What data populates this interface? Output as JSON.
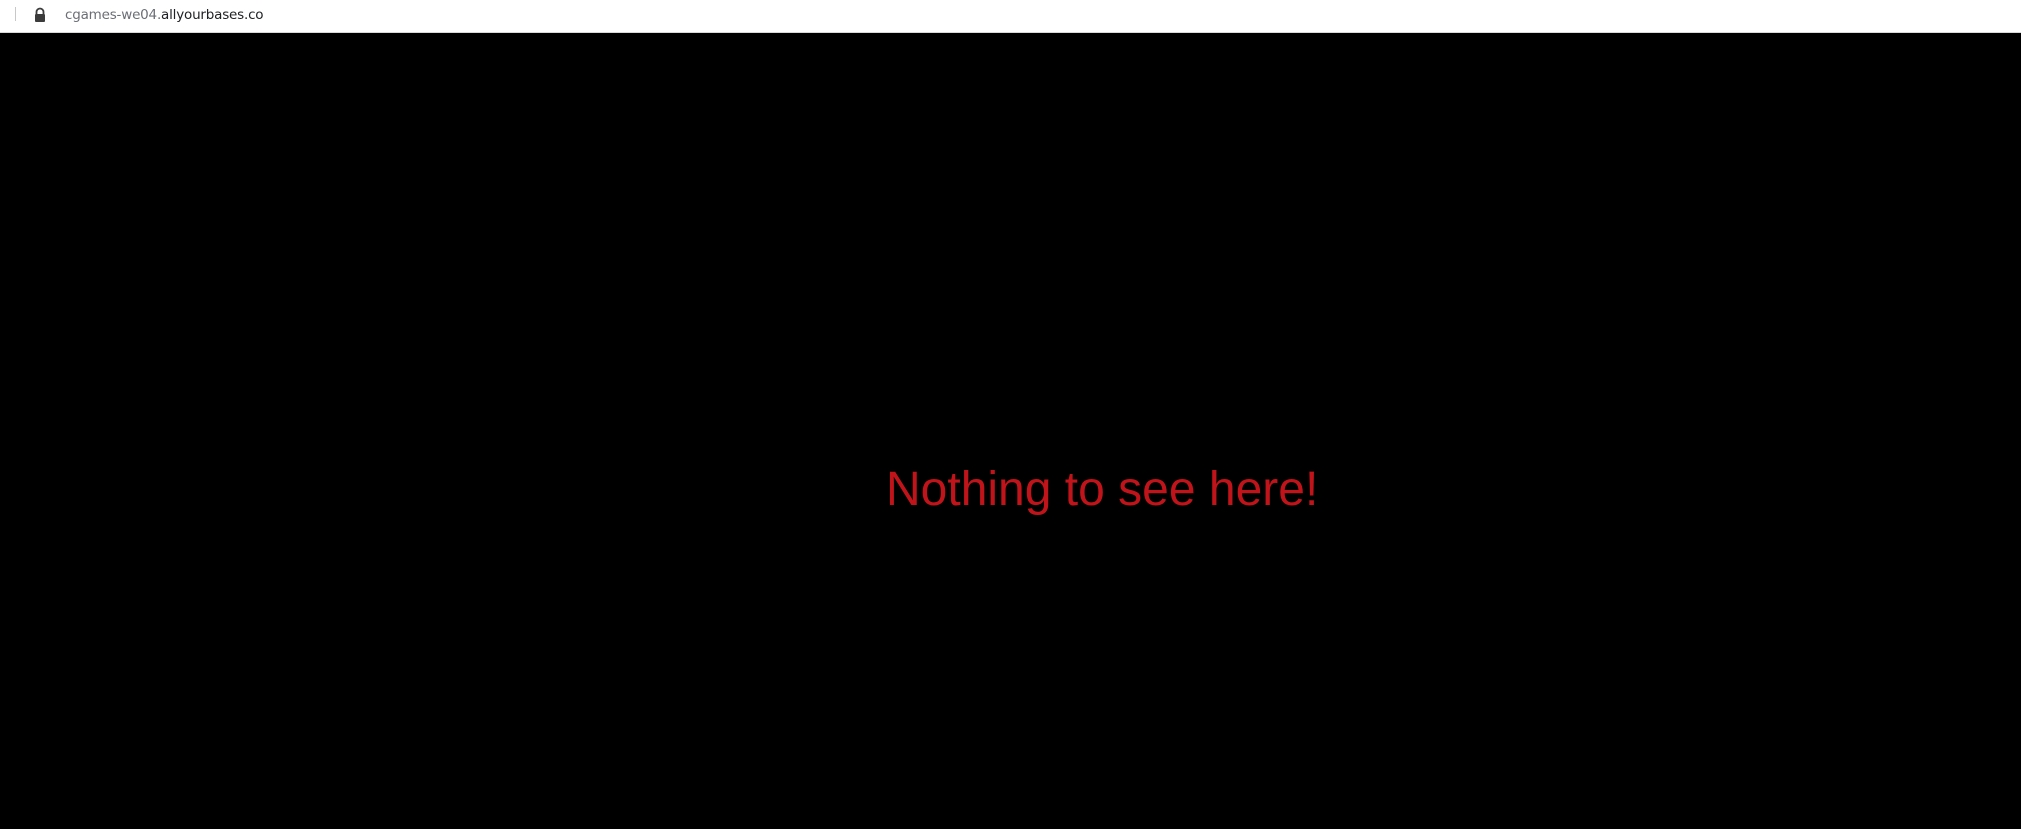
{
  "addressbar": {
    "subdomain": "cgames-we04.",
    "domain": "allyourbases.co",
    "secure_icon": "lock-icon"
  },
  "page": {
    "message": "Nothing to see here!",
    "background_color": "#000000",
    "message_color": "#c0141a"
  }
}
